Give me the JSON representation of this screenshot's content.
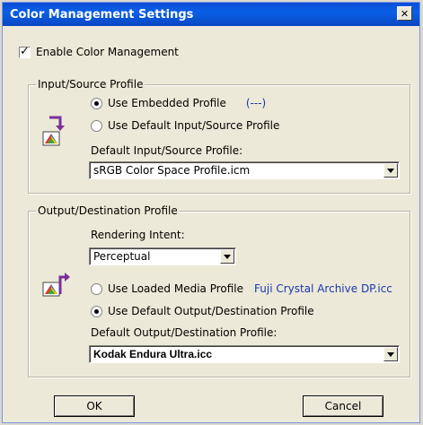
{
  "window": {
    "title": "Color Management Settings",
    "close_glyph": "✕"
  },
  "enable": {
    "label": "Enable Color Management",
    "checked": true
  },
  "input_group": {
    "legend": "Input/Source Profile",
    "radio_embedded": "Use Embedded Profile",
    "embedded_value": "(---)",
    "radio_default": "Use Default Input/Source Profile",
    "default_label": "Default Input/Source Profile:",
    "default_value": "sRGB Color Space Profile.icm"
  },
  "output_group": {
    "legend": "Output/Destination Profile",
    "intent_label": "Rendering Intent:",
    "intent_value": "Perceptual",
    "radio_loaded": "Use Loaded Media Profile",
    "loaded_value": "Fuji Crystal Archive DP.icc",
    "radio_default": "Use Default Output/Destination Profile",
    "default_label": "Default Output/Destination Profile:",
    "default_value": "Kodak Endura Ultra.icc"
  },
  "buttons": {
    "ok": "OK",
    "cancel": "Cancel"
  },
  "icons": {
    "close": "close-icon",
    "input_profile": "input-profile-icon",
    "output_profile": "output-profile-icon",
    "dropdown": "chevron-down-icon"
  },
  "colors": {
    "title_bar": "#0a5fe6",
    "dialog_bg": "#ece9d8",
    "link_text": "#1b37b0",
    "arrow_purple": "#7a2f9a"
  }
}
